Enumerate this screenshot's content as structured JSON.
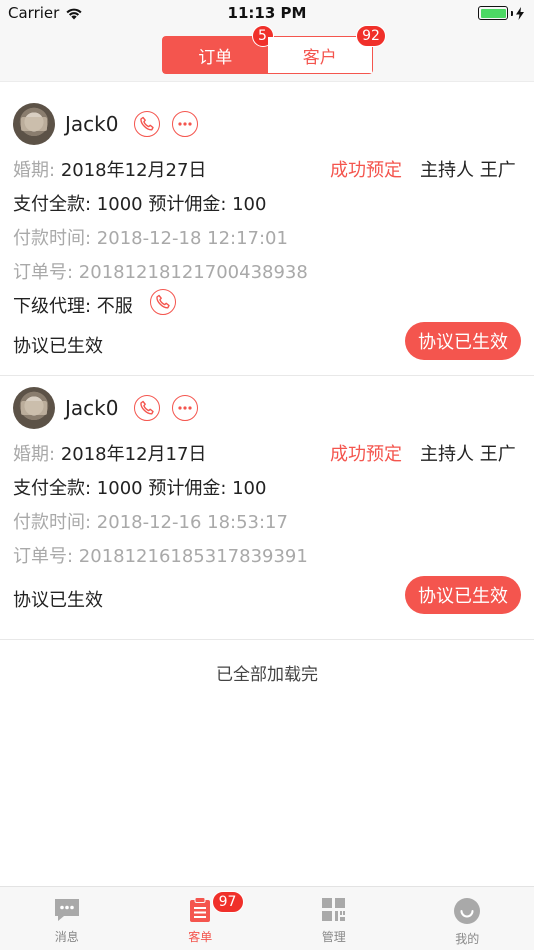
{
  "status_bar": {
    "carrier": "Carrier",
    "time": "11:13 PM"
  },
  "segment": {
    "tabs": [
      {
        "label": "订单",
        "badge": "5",
        "active": true
      },
      {
        "label": "客户",
        "badge": "92",
        "active": false
      }
    ]
  },
  "orders": [
    {
      "name": "Jack0",
      "wedding_label": "婚期:",
      "wedding_date": "2018年12月27日",
      "status": "成功预定",
      "host": "主持人 王广",
      "payment": "支付全款: 1000  预计佣金: 100",
      "pay_time": "付款时间: 2018-12-18 12:17:01",
      "order_no": "订单号: 20181218121700438938",
      "sub_agent": "下级代理: 不服",
      "agreement_text": "协议已生效",
      "agreement_button": "协议已生效"
    },
    {
      "name": "Jack0",
      "wedding_label": "婚期:",
      "wedding_date": "2018年12月17日",
      "status": "成功预定",
      "host": "主持人 王广",
      "payment": "支付全款: 1000  预计佣金: 100",
      "pay_time": "付款时间: 2018-12-16 18:53:17",
      "order_no": "订单号: 20181216185317839391",
      "agreement_text": "协议已生效",
      "agreement_button": "协议已生效"
    }
  ],
  "end_message": "已全部加载完",
  "tabbar": {
    "tabs": [
      {
        "label": "消息",
        "icon": "message-icon"
      },
      {
        "label": "客单",
        "icon": "order-list-icon",
        "badge": "97",
        "active": true
      },
      {
        "label": "管理",
        "icon": "grid-manage-icon"
      },
      {
        "label": "我的",
        "icon": "profile-icon"
      }
    ]
  },
  "colors": {
    "accent": "#f4554e",
    "badge": "#f0302a",
    "battery": "#4cd964"
  }
}
